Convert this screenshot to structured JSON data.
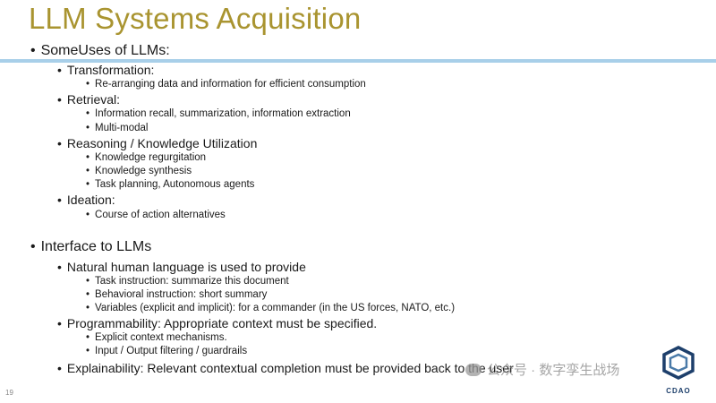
{
  "title": "LLM Systems Acquisition",
  "page_number": "19",
  "logo_text": "CDAO",
  "watermark": "公众号 · 数字孪生战场",
  "bullet_char": "•",
  "sections": [
    {
      "label": "SomeUses of LLMs:",
      "items": [
        {
          "label": "Transformation:",
          "sub": [
            "Re-arranging data and information for efficient consumption"
          ]
        },
        {
          "label": "Retrieval:",
          "sub": [
            "Information recall, summarization, information extraction",
            "Multi-modal"
          ]
        },
        {
          "label": "Reasoning / Knowledge Utilization",
          "sub": [
            "Knowledge regurgitation",
            "Knowledge synthesis",
            "Task planning, Autonomous agents"
          ]
        },
        {
          "label": "Ideation:",
          "sub": [
            "Course of action alternatives"
          ]
        }
      ]
    },
    {
      "label": "Interface to LLMs",
      "items": [
        {
          "label": "Natural human language is used to provide",
          "sub": [
            "Task instruction: summarize this document",
            "Behavioral instruction: short summary",
            "Variables (explicit and implicit): for a commander (in the US forces, NATO, etc.)"
          ]
        },
        {
          "label": "Programmability: Appropriate context must be specified.",
          "sub": [
            "Explicit context mechanisms.",
            "Input / Output filtering / guardrails"
          ]
        },
        {
          "label": "Explainability: Relevant contextual completion must be provided back to the user",
          "sub": []
        }
      ]
    }
  ]
}
